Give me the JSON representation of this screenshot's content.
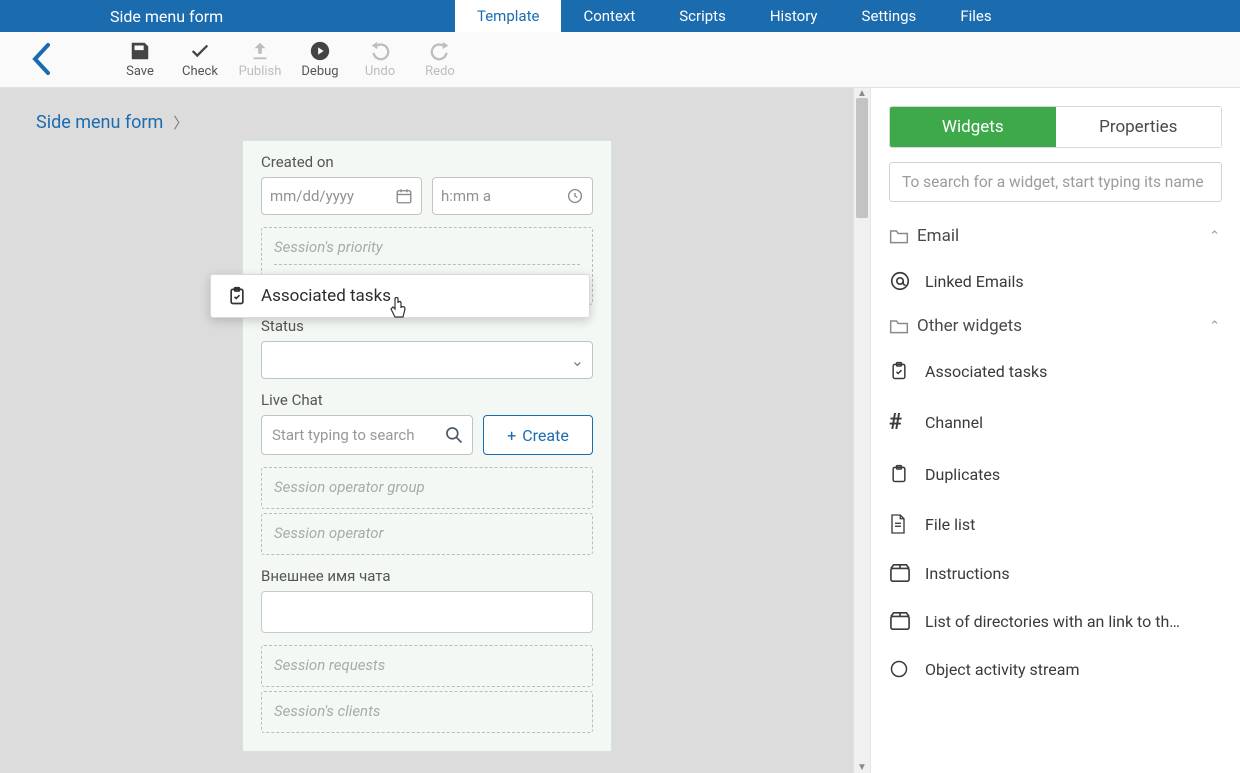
{
  "header": {
    "title": "Side menu form",
    "tabs": [
      "Template",
      "Context",
      "Scripts",
      "History",
      "Settings",
      "Files"
    ],
    "active_tab": 0
  },
  "toolbar": {
    "items": [
      {
        "label": "Save",
        "enabled": true
      },
      {
        "label": "Check",
        "enabled": true
      },
      {
        "label": "Publish",
        "enabled": false
      },
      {
        "label": "Debug",
        "enabled": true
      },
      {
        "label": "Undo",
        "enabled": false
      },
      {
        "label": "Redo",
        "enabled": false
      }
    ]
  },
  "breadcrumb": {
    "root": "Side menu form"
  },
  "form": {
    "created_on_label": "Created on",
    "date_placeholder": "mm/dd/yyyy",
    "time_placeholder": "h:mm a",
    "priority_placeholder": "Session's priority",
    "status_label": "Status",
    "live_chat_label": "Live Chat",
    "live_chat_search_placeholder": "Start typing to search",
    "create_button_label": "Create",
    "operator_group_placeholder": "Session operator group",
    "operator_placeholder": "Session operator",
    "ext_name_label": "Внешнее имя чата",
    "requests_placeholder": "Session requests",
    "clients_placeholder": "Session's clients"
  },
  "drag": {
    "tooltip_label": "Associated tasks"
  },
  "side": {
    "tabs": {
      "widgets": "Widgets",
      "properties": "Properties",
      "active": 0
    },
    "search_placeholder": "To search for a widget, start typing its name",
    "groups": [
      {
        "name": "Email",
        "items": [
          {
            "label": "Linked Emails",
            "icon": "at"
          }
        ]
      },
      {
        "name": "Other widgets",
        "items": [
          {
            "label": "Associated tasks",
            "icon": "clipboard"
          },
          {
            "label": "Channel",
            "icon": "hash"
          },
          {
            "label": "Duplicates",
            "icon": "clipboard"
          },
          {
            "label": "File list",
            "icon": "file"
          },
          {
            "label": "Instructions",
            "icon": "package"
          },
          {
            "label": "List of directories with an link to th…",
            "icon": "package"
          },
          {
            "label": "Object activity stream",
            "icon": "generic"
          }
        ]
      }
    ]
  }
}
